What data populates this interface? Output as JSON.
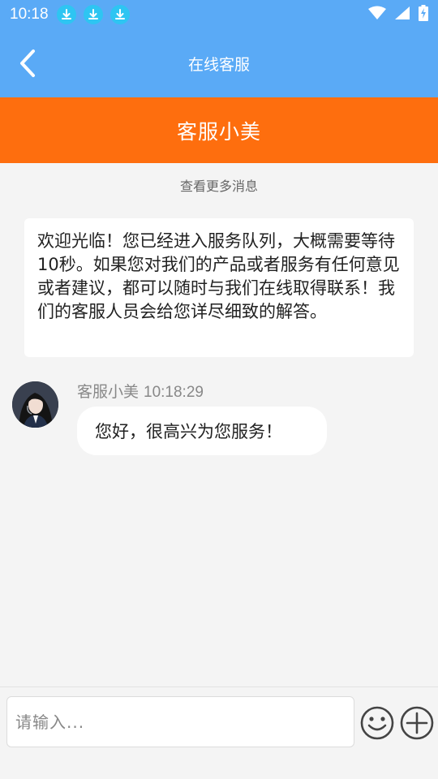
{
  "status_bar": {
    "time": "10:18",
    "icons": [
      "download-icon",
      "download-icon",
      "download-icon",
      "wifi-icon",
      "signal-icon",
      "battery-charging-icon"
    ]
  },
  "header": {
    "title": "在线客服",
    "back_icon": "chevron-left-icon"
  },
  "agent_bar": {
    "name": "客服小美"
  },
  "chat": {
    "load_more": "查看更多消息",
    "welcome": "欢迎光临！您已经进入服务队列，大概需要等待10秒。如果您对我们的产品或者服务有任何意见或者建议，都可以随时与我们在线取得联系！我们的客服人员会给您详尽细致的解答。",
    "messages": [
      {
        "sender": "客服小美",
        "time": "10:18:29",
        "text": "您好，很高兴为您服务！"
      }
    ]
  },
  "input_bar": {
    "placeholder": "请输入...",
    "value": "",
    "emoji_icon": "smiley-icon",
    "plus_icon": "plus-circle-icon"
  },
  "colors": {
    "header_blue": "#5aaaf6",
    "agent_orange": "#fe6e0e",
    "download_badge": "#2ec5f2",
    "background": "#f4f4f4"
  }
}
